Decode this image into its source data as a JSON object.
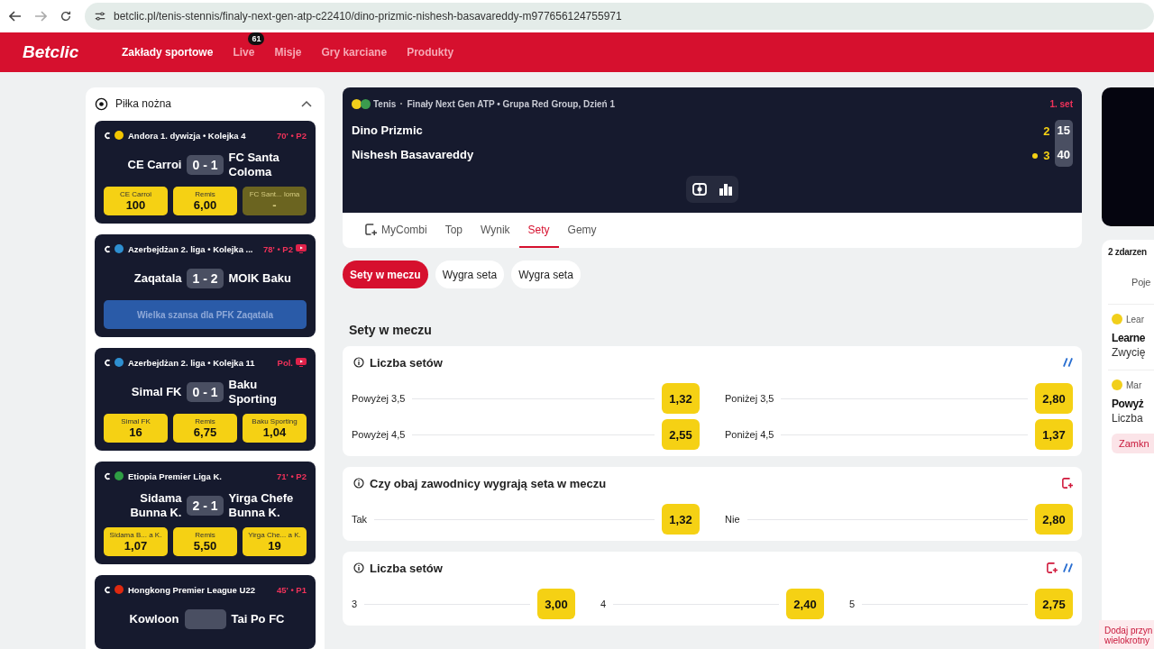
{
  "browser": {
    "url": "betclic.pl/tenis-stennis/finaly-next-gen-atp-c22410/dino-prizmic-nishesh-basavareddy-m977656124755971"
  },
  "nav": {
    "logo": "Betclic",
    "items": [
      {
        "label": "Zakłady sportowe",
        "selected": true
      },
      {
        "label": "Live",
        "selected": false,
        "badge": "61"
      },
      {
        "label": "Misje",
        "selected": false
      },
      {
        "label": "Gry karciane",
        "selected": false
      },
      {
        "label": "Produkty",
        "selected": false
      }
    ]
  },
  "sidebar": {
    "title": "Piłka nożna",
    "expanded": true,
    "matches": [
      {
        "kind": "odds",
        "league": "Andora 1. dywizja • Kolejka 4",
        "color": "#f2c500",
        "time": "70' • P2",
        "stream": false,
        "home": "CE Carroi",
        "score": "0 - 1",
        "away": "FC Santa Coloma",
        "odds": [
          {
            "label": "CE Carroi",
            "value": "100",
            "disabled": false
          },
          {
            "label": "Remis",
            "value": "6,00",
            "disabled": false
          },
          {
            "label": "FC Sant... loma",
            "value": "-",
            "disabled": true
          }
        ]
      },
      {
        "kind": "promo",
        "league": "Azerbejdżan 2. liga • Kolejka ...",
        "color": "#2e8fd0",
        "time": "78' • P2",
        "stream": true,
        "home": "Zaqatala",
        "score": "1 - 2",
        "away": "MOIK Baku",
        "promo": "Wielka szansa dla PFK Zaqatala"
      },
      {
        "kind": "odds",
        "league": "Azerbejdżan 2. liga • Kolejka 11",
        "color": "#2e8fd0",
        "time": "Pol.",
        "stream": true,
        "home": "Simal FK",
        "score": "0 - 1",
        "away": "Baku Sporting",
        "odds": [
          {
            "label": "Simal FK",
            "value": "16",
            "disabled": false
          },
          {
            "label": "Remis",
            "value": "6,75",
            "disabled": false
          },
          {
            "label": "Baku Sporting",
            "value": "1,04",
            "disabled": false
          }
        ]
      },
      {
        "kind": "odds",
        "league": "Etiopia Premier Liga K.",
        "color": "#2f9e44",
        "time": "71' • P2",
        "stream": false,
        "home": "Sidama Bunna K.",
        "score": "2 - 1",
        "away": "Yirga Chefe Bunna K.",
        "odds": [
          {
            "label": "Sidama B... a K.",
            "value": "1,07",
            "disabled": false
          },
          {
            "label": "Remis",
            "value": "5,50",
            "disabled": false
          },
          {
            "label": "Yirga Che... a K.",
            "value": "19",
            "disabled": false
          }
        ]
      },
      {
        "kind": "cut",
        "league": "Hongkong Premier League U22",
        "color": "#de2910",
        "time": "45' • P1",
        "stream": false,
        "home": "Kowloon",
        "away": "Tai Po FC"
      }
    ]
  },
  "match": {
    "sport": "Tenis",
    "competition": "Finały Next Gen ATP • Grupa Red Group, Dzień 1",
    "period": "1. set",
    "players": [
      {
        "name": "Dino Prizmic",
        "sets": "2",
        "points": "15",
        "serving": false
      },
      {
        "name": "Nishesh Basavareddy",
        "sets": "3",
        "points": "40",
        "serving": true
      }
    ]
  },
  "tabs": [
    {
      "label": "MyCombi",
      "selected": false,
      "icon": true
    },
    {
      "label": "Top",
      "selected": false,
      "icon": false
    },
    {
      "label": "Wynik",
      "selected": false,
      "icon": false
    },
    {
      "label": "Sety",
      "selected": true,
      "icon": false
    },
    {
      "label": "Gemy",
      "selected": false,
      "icon": false
    }
  ],
  "chips": [
    {
      "label": "Sety w meczu",
      "selected": true
    },
    {
      "label": "Wygra seta",
      "selected": false
    },
    {
      "label": "Wygra seta",
      "selected": false
    }
  ],
  "section_title": "Sety w meczu",
  "markets": [
    {
      "title": "Liczba setów",
      "mycombi": false,
      "builder": true,
      "rows": [
        [
          {
            "label": "Powyżej 3,5",
            "odds": "1,32"
          },
          {
            "label": "Poniżej 3,5",
            "odds": "2,80"
          }
        ],
        [
          {
            "label": "Powyżej 4,5",
            "odds": "2,55"
          },
          {
            "label": "Poniżej 4,5",
            "odds": "1,37"
          }
        ]
      ]
    },
    {
      "title": "Czy obaj zawodnicy wygrają seta w meczu",
      "mycombi": true,
      "builder": false,
      "rows": [
        [
          {
            "label": "Tak",
            "odds": "1,32"
          },
          {
            "label": "Nie",
            "odds": "2,80"
          }
        ]
      ]
    },
    {
      "title": "Liczba setów",
      "mycombi": true,
      "builder": true,
      "rows": [
        [
          {
            "label": "3",
            "odds": "3,00"
          },
          {
            "label": "4",
            "odds": "2,40"
          },
          {
            "label": "5",
            "odds": "2,75"
          }
        ]
      ]
    }
  ],
  "betslip": {
    "count": "2 zdarzen",
    "tab": "Poje",
    "entries": [
      {
        "league": "Lear",
        "title": "Learne",
        "sub": "Zwycię"
      },
      {
        "league": "Mar",
        "title": "Powyż",
        "sub": "Liczba",
        "action": "Zamkn"
      }
    ],
    "notice": [
      "Dodaj przyn",
      "wielokrotny"
    ]
  }
}
